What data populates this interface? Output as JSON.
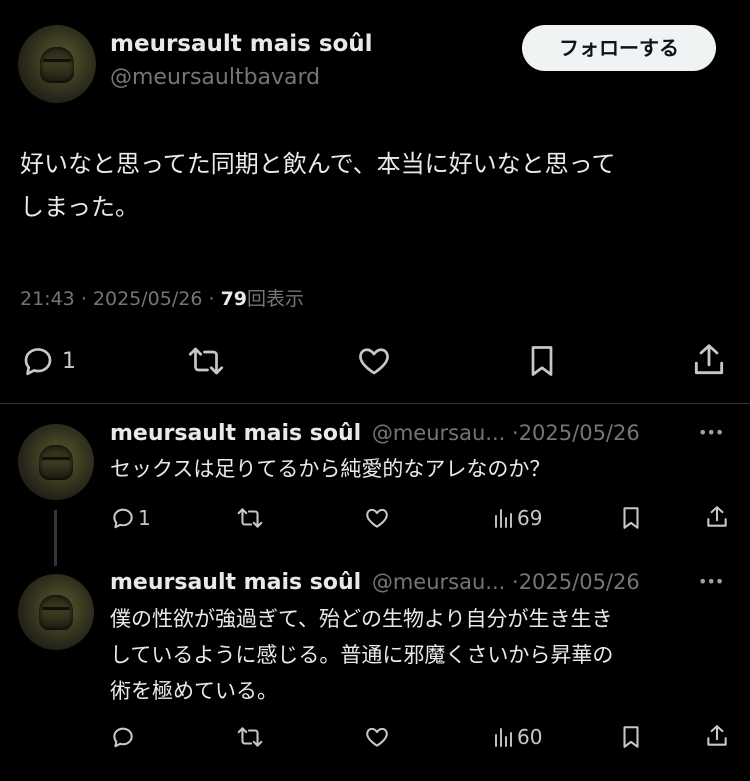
{
  "main_tweet": {
    "display_name": "meursault mais soûl",
    "handle": "@meursaultbavard",
    "follow_label": "フォローする",
    "text_line1": "好いなと思ってた同期と飲んで、本当に好いなと思って",
    "text_line2": "しまった。",
    "time": "21:43",
    "sep1": "·",
    "date": "2025/05/26",
    "sep2": "·",
    "views_count": "79",
    "views_label": "回表示",
    "reply_count": "1",
    "icons": [
      "reply-icon",
      "retweet-icon",
      "like-icon",
      "bookmark-icon",
      "share-icon"
    ]
  },
  "replies": [
    {
      "display_name": "meursault mais soûl",
      "handle": "@meursau...",
      "sep": "·",
      "date": "2025/05/26",
      "more": "•••",
      "text_lines": [
        "セックスは足りてるから純愛的なアレなのか？"
      ],
      "reply_count": "1",
      "views_count": "69"
    },
    {
      "display_name": "meursault mais soûl",
      "handle": "@meursau...",
      "sep": "·",
      "date": "2025/05/26",
      "more": "•••",
      "text_lines": [
        "僕の性欲が強過ぎて、殆どの生物より自分が生き生き",
        "しているように感じる。普通に邪魔くさいから昇華の",
        "術を極めている。"
      ],
      "reply_count": "",
      "views_count": "60"
    }
  ],
  "colors": {
    "background": "#000000",
    "text": "#e7e9ea",
    "muted": "#71767b",
    "divider": "#2f3336",
    "follow_bg": "#eff3f4",
    "follow_text": "#0f1419"
  }
}
